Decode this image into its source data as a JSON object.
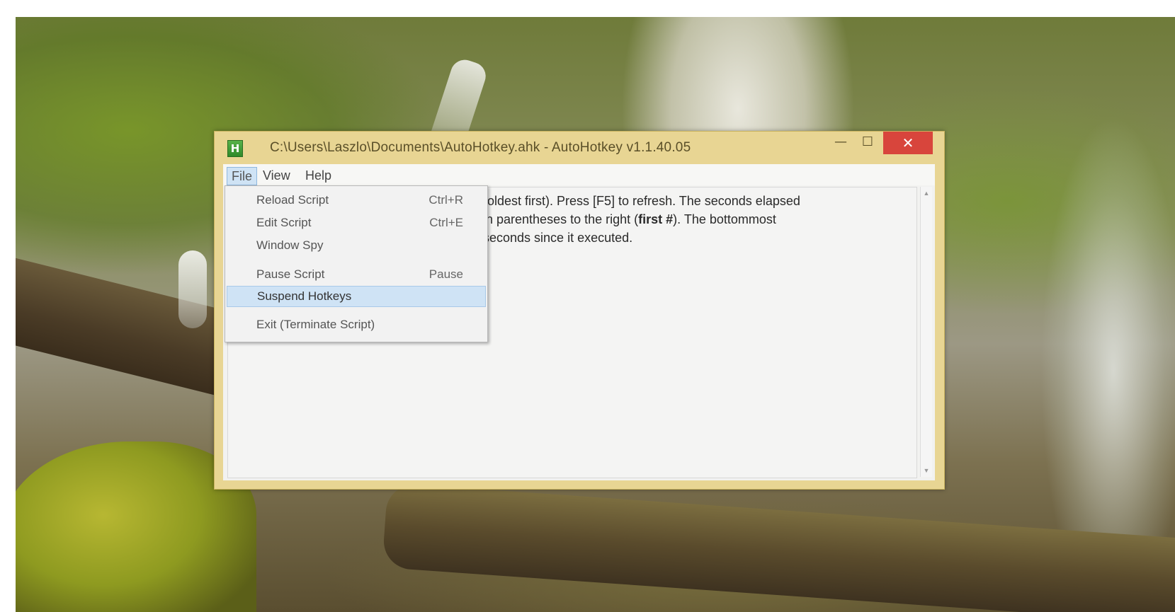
{
  "window": {
    "title": "C:\\Users\\Laszlo\\Documents\\AutoHotkey.ahk - AutoHotkey v1.1.40.05",
    "icon": "H",
    "controls": {
      "minimize": "—",
      "maximize": "☐",
      "close": "✕"
    }
  },
  "menubar": {
    "file": "File",
    "view": "View",
    "help": "Help"
  },
  "file_menu": {
    "items": [
      {
        "label": "Reload Script",
        "shortcut": "Ctrl+R"
      },
      {
        "label": "Edit Script",
        "shortcut": "Ctrl+E"
      },
      {
        "label": "Window Spy",
        "shortcut": ""
      },
      {
        "label": "Pause Script",
        "shortcut": "Pause"
      },
      {
        "label": "Suspend Hotkeys",
        "shortcut": ""
      },
      {
        "label": "Exit (Terminate Script)",
        "shortcut": ""
      }
    ],
    "highlighted": "Suspend Hotkeys"
  },
  "content": {
    "line1_a": "(oldest first). Press [F5] to refresh. The seconds elapsed",
    "line2_a": "in parentheses to the right (",
    "line2_bold": "first #",
    "line2_b": "). The bottommost",
    "line3": "seconds since it executed."
  },
  "colors": {
    "title_bar": "#e8d593",
    "close_button": "#d8453c",
    "menu_highlight": "#cfe3f5"
  }
}
